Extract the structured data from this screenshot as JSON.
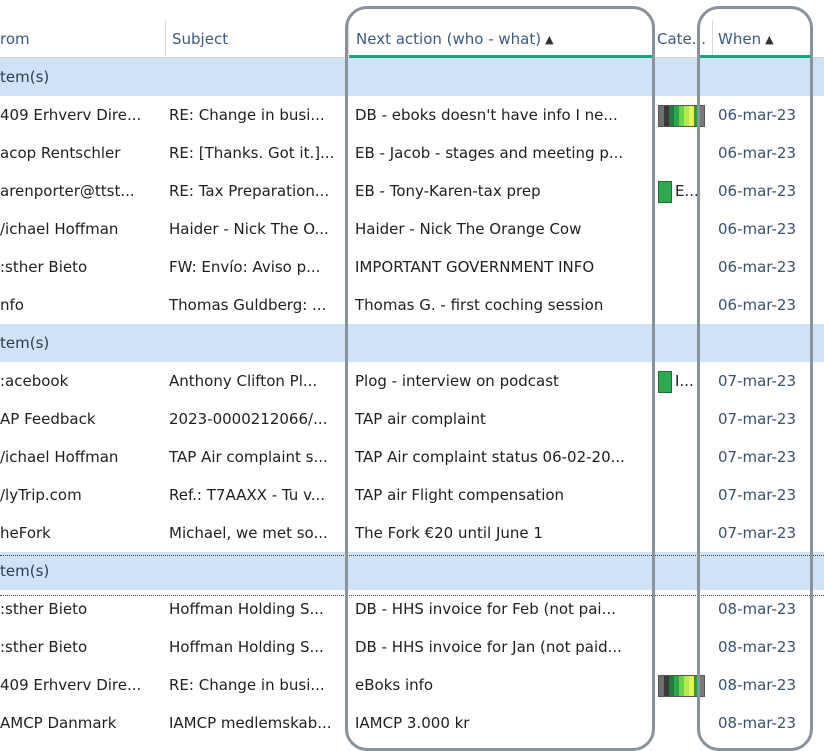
{
  "columns": {
    "from": "rom",
    "subject": "Subject",
    "next_action": "Next action (who - what)",
    "category": "Cate...",
    "when": "When",
    "sort_ascending_glyph": "▲"
  },
  "groups": [
    {
      "label": "tem(s)",
      "rows": [
        {
          "from": "409 Erhverv Dire...",
          "subject": "RE: Change in busi...",
          "next_action": "DB - eboks doesn't have info I ne...",
          "category": "multicolor",
          "category_text": "",
          "when": "06-mar-23"
        },
        {
          "from": "acop Rentschler",
          "subject": "RE: [Thanks. Got it.]...",
          "next_action": "EB - Jacob - stages and meeting p...",
          "category": "",
          "category_text": "",
          "when": "06-mar-23"
        },
        {
          "from": "arenporter@ttst...",
          "subject": "RE: Tax Preparation...",
          "next_action": "EB - Tony-Karen-tax prep",
          "category": "green",
          "category_text": "E...",
          "when": "06-mar-23"
        },
        {
          "from": "/ichael Hoffman",
          "subject": "Haider - Nick The O...",
          "next_action": "Haider - Nick The Orange Cow",
          "category": "",
          "category_text": "",
          "when": "06-mar-23"
        },
        {
          "from": ":sther Bieto",
          "subject": "FW: Envío: Aviso p...",
          "next_action": "IMPORTANT GOVERNMENT INFO",
          "category": "",
          "category_text": "",
          "when": "06-mar-23"
        },
        {
          "from": "nfo",
          "subject": "Thomas Guldberg: ...",
          "next_action": "Thomas G.  - first coching session",
          "category": "",
          "category_text": "",
          "when": "06-mar-23"
        }
      ]
    },
    {
      "label": "tem(s)",
      "rows": [
        {
          "from": ":acebook",
          "subject": "Anthony Clifton Pl...",
          "next_action": "Plog - interview on podcast",
          "category": "green",
          "category_text": "I...",
          "when": "07-mar-23"
        },
        {
          "from": "AP Feedback",
          "subject": "2023-0000212066/...",
          "next_action": "TAP air complaint",
          "category": "",
          "category_text": "",
          "when": "07-mar-23"
        },
        {
          "from": "/ichael Hoffman",
          "subject": "TAP Air complaint s...",
          "next_action": "TAP Air complaint status 06-02-20...",
          "category": "",
          "category_text": "",
          "when": "07-mar-23"
        },
        {
          "from": "/lyTrip.com",
          "subject": "Ref.: T7AAXX - Tu v...",
          "next_action": "TAP air Flight compensation",
          "category": "",
          "category_text": "",
          "when": "07-mar-23"
        },
        {
          "from": "heFork",
          "subject": "Michael, we met so...",
          "next_action": "The Fork €20 until June 1",
          "category": "",
          "category_text": "",
          "when": "07-mar-23"
        }
      ]
    },
    {
      "label": "tem(s)",
      "rows": [
        {
          "from": ":sther Bieto",
          "subject": "Hoffman Holding S...",
          "next_action": "DB - HHS invoice for Feb (not pai...",
          "category": "",
          "category_text": "",
          "when": "08-mar-23"
        },
        {
          "from": ":sther Bieto",
          "subject": "Hoffman Holding S...",
          "next_action": "DB - HHS invoice for Jan (not paid...",
          "category": "",
          "category_text": "",
          "when": "08-mar-23"
        },
        {
          "from": "409 Erhverv Dire...",
          "subject": "RE: Change in busi...",
          "next_action": "eBoks info",
          "category": "multicolor",
          "category_text": "",
          "when": "08-mar-23"
        },
        {
          "from": "AMCP Danmark",
          "subject": "IAMCP medlemskab...",
          "next_action": "IAMCP 3.000 kr",
          "category": "",
          "category_text": "",
          "when": "08-mar-23"
        }
      ]
    }
  ],
  "colors": {
    "header_text": "#3b5a86",
    "group_background": "#cfe3f6",
    "sort_underline": "#1ba57c",
    "category_green": "#2fa84f",
    "highlight_outline": "#8a929b"
  }
}
